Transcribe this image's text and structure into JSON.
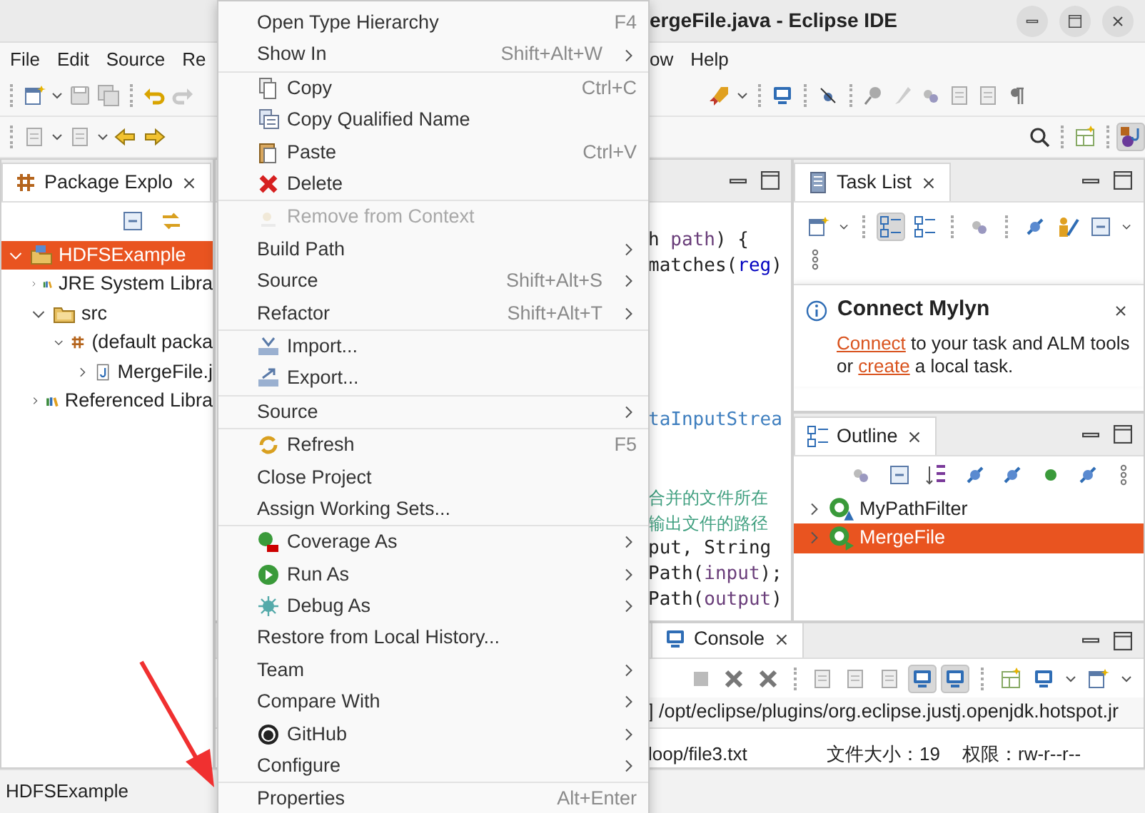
{
  "window": {
    "title": "ergeFile.java - Eclipse IDE"
  },
  "menu_bar": {
    "left": [
      "File",
      "Edit",
      "Source",
      "Re"
    ],
    "right": [
      "ow",
      "Help"
    ]
  },
  "package_explorer": {
    "tab": "Package Explo",
    "tree": [
      {
        "label": "HDFSExample",
        "kind": "project",
        "expanded": true,
        "selected": true,
        "children": [
          {
            "label": "JRE System Libra",
            "kind": "library",
            "expanded": false,
            "selected": false
          },
          {
            "label": "src",
            "kind": "folder",
            "expanded": true,
            "selected": false,
            "children": [
              {
                "label": "(default packa",
                "kind": "package",
                "expanded": true,
                "selected": false,
                "children": [
                  {
                    "label": "MergeFile.j",
                    "kind": "java",
                    "expanded": false,
                    "selected": false
                  }
                ]
              }
            ]
          },
          {
            "label": "Referenced Libra",
            "kind": "library",
            "expanded": false,
            "selected": false
          }
        ]
      }
    ]
  },
  "editor": {
    "code_blocks": [
      [
        [
          {
            "text": "h ",
            "kind": "plain"
          },
          {
            "text": "path",
            "kind": "variable"
          },
          {
            "text": ") {",
            "kind": "plain"
          }
        ],
        [
          {
            "text": "matches(",
            "kind": "plain"
          },
          {
            "text": "reg",
            "kind": "field"
          },
          {
            "text": ")",
            "kind": "plain"
          }
        ]
      ],
      [
        [
          {
            "text": "taInputStrea",
            "kind": "link"
          }
        ]
      ],
      [
        [
          {
            "text": "合并的文件所在",
            "kind": "comment"
          }
        ],
        [
          {
            "text": "输出文件的路径",
            "kind": "comment"
          }
        ],
        [
          {
            "text": "put, String",
            "kind": "plain"
          }
        ],
        [
          {
            "text": "Path(",
            "kind": "plain"
          },
          {
            "text": "input",
            "kind": "variable"
          },
          {
            "text": ");",
            "kind": "plain"
          }
        ],
        [
          {
            "text": "Path(",
            "kind": "plain"
          },
          {
            "text": "output",
            "kind": "variable"
          },
          {
            "text": ")",
            "kind": "plain"
          }
        ]
      ]
    ]
  },
  "task_list": {
    "tab": "Task List",
    "toolbar": [
      {
        "kind": "new-task",
        "pressed": false
      },
      {
        "kind": "categorized",
        "pressed": true
      },
      {
        "kind": "scheduled",
        "pressed": false
      },
      {
        "kind": "synchronize",
        "pressed": false
      },
      {
        "kind": "focus",
        "pressed": false
      },
      {
        "kind": "people",
        "pressed": false
      },
      {
        "kind": "collapse",
        "pressed": false
      }
    ]
  },
  "mylyn_popup": {
    "title": "Connect Mylyn",
    "message": [
      {
        "text": "Connect",
        "link": true
      },
      {
        "text": " to your task and ALM tools or ",
        "link": false
      },
      {
        "text": "create",
        "link": true
      },
      {
        "text": " a local task.",
        "link": false
      }
    ]
  },
  "outline": {
    "tab": "Outline",
    "items": [
      {
        "label": "MyPathFilter",
        "kind": "class-filter",
        "selected": false
      },
      {
        "label": "MergeFile",
        "kind": "class-main",
        "selected": true
      }
    ]
  },
  "console": {
    "tab": "Console",
    "toolbar": [
      {
        "kind": "terminate",
        "pressed": false
      },
      {
        "kind": "remove",
        "pressed": false
      },
      {
        "kind": "remove-all",
        "pressed": false
      },
      {
        "kind": "clear",
        "pressed": false
      },
      {
        "kind": "scroll-lock",
        "pressed": false
      },
      {
        "kind": "word-wrap",
        "pressed": false
      },
      {
        "kind": "stdout",
        "pressed": true
      },
      {
        "kind": "stderr",
        "pressed": true
      },
      {
        "kind": "pin",
        "pressed": false
      },
      {
        "kind": "display",
        "pressed": false
      },
      {
        "kind": "new-console",
        "pressed": false
      }
    ],
    "header": "] /opt/eclipse/plugins/org.eclipse.justj.openjdk.hotspot.jr",
    "lines": [
      [
        "loop/file3.txt",
        "文件大小：19",
        "权限：rw-r--r--"
      ]
    ]
  },
  "status_bar": {
    "text": "HDFSExample"
  },
  "context_menu": [
    {
      "kind": "plain",
      "label": "Open Type Hierarchy",
      "shortcut": "F4",
      "submenu": false,
      "disabled": false
    },
    {
      "kind": "plain",
      "label": "Show In",
      "shortcut": "Shift+Alt+W",
      "submenu": true,
      "disabled": false
    },
    {
      "kind": "separator"
    },
    {
      "kind": "copy",
      "label": "Copy",
      "shortcut": "Ctrl+C",
      "submenu": false,
      "disabled": false
    },
    {
      "kind": "copy-qualified",
      "label": "Copy Qualified Name",
      "submenu": false,
      "disabled": false
    },
    {
      "kind": "paste",
      "label": "Paste",
      "shortcut": "Ctrl+V",
      "submenu": false,
      "disabled": false
    },
    {
      "kind": "delete",
      "label": "Delete",
      "submenu": false,
      "disabled": false
    },
    {
      "kind": "separator"
    },
    {
      "kind": "remove-context",
      "label": "Remove from Context",
      "submenu": false,
      "disabled": true
    },
    {
      "kind": "plain",
      "label": "Build Path",
      "submenu": true,
      "disabled": false
    },
    {
      "kind": "plain",
      "label": "Source",
      "shortcut": "Shift+Alt+S",
      "submenu": true,
      "disabled": false
    },
    {
      "kind": "plain",
      "label": "Refactor",
      "shortcut": "Shift+Alt+T",
      "submenu": true,
      "disabled": false
    },
    {
      "kind": "separator"
    },
    {
      "kind": "import",
      "label": "Import...",
      "submenu": false,
      "disabled": false
    },
    {
      "kind": "export",
      "label": "Export...",
      "submenu": false,
      "disabled": false
    },
    {
      "kind": "separator"
    },
    {
      "kind": "plain",
      "label": "Source",
      "submenu": true,
      "disabled": false
    },
    {
      "kind": "separator"
    },
    {
      "kind": "refresh",
      "label": "Refresh",
      "shortcut": "F5",
      "submenu": false,
      "disabled": false
    },
    {
      "kind": "plain",
      "label": "Close Project",
      "submenu": false,
      "disabled": false
    },
    {
      "kind": "plain",
      "label": "Assign Working Sets...",
      "submenu": false,
      "disabled": false
    },
    {
      "kind": "separator"
    },
    {
      "kind": "coverage",
      "label": "Coverage As",
      "submenu": true,
      "disabled": false
    },
    {
      "kind": "run",
      "label": "Run As",
      "submenu": true,
      "disabled": false
    },
    {
      "kind": "debug",
      "label": "Debug As",
      "submenu": true,
      "disabled": false
    },
    {
      "kind": "plain",
      "label": "Restore from Local History...",
      "submenu": false,
      "disabled": false
    },
    {
      "kind": "plain",
      "label": "Team",
      "submenu": true,
      "disabled": false
    },
    {
      "kind": "plain",
      "label": "Compare With",
      "submenu": true,
      "disabled": false
    },
    {
      "kind": "github",
      "label": "GitHub",
      "submenu": true,
      "disabled": false
    },
    {
      "kind": "plain",
      "label": "Configure",
      "submenu": true,
      "disabled": false
    },
    {
      "kind": "separator"
    },
    {
      "kind": "plain",
      "label": "Properties",
      "shortcut": "Alt+Enter",
      "submenu": false,
      "disabled": false
    }
  ]
}
